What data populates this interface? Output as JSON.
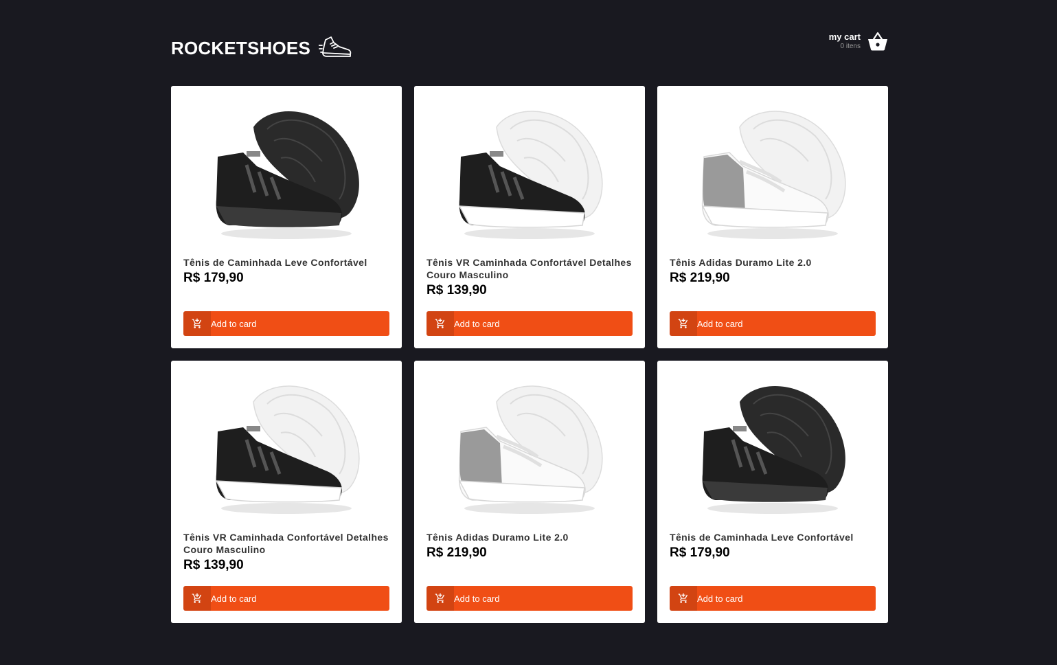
{
  "header": {
    "logo_text": "ROCKETSHOES",
    "logo_icon": "running-shoe-icon",
    "cart_title": "my cart",
    "cart_count": "0 itens",
    "cart_icon": "shopping-basket-icon"
  },
  "colors": {
    "background": "#191920",
    "accent": "#f04e15",
    "card": "#ffffff"
  },
  "products": [
    {
      "title": "Tênis de Caminhada Leve Confortável",
      "price": "R$ 179,90",
      "button_label": "Add to card",
      "button_icon": "add-shopping-cart-icon",
      "shoe": "black"
    },
    {
      "title": "Tênis VR Caminhada Confortável Detalhes Couro Masculino",
      "price": "R$ 139,90",
      "button_label": "Add to card",
      "button_icon": "add-shopping-cart-icon",
      "shoe": "black-white"
    },
    {
      "title": "Tênis Adidas Duramo Lite 2.0",
      "price": "R$ 219,90",
      "button_label": "Add to card",
      "button_icon": "add-shopping-cart-icon",
      "shoe": "white-grey"
    },
    {
      "title": "Tênis VR Caminhada Confortável Detalhes Couro Masculino",
      "price": "R$ 139,90",
      "button_label": "Add to card",
      "button_icon": "add-shopping-cart-icon",
      "shoe": "black-white"
    },
    {
      "title": "Tênis Adidas Duramo Lite 2.0",
      "price": "R$ 219,90",
      "button_label": "Add to card",
      "button_icon": "add-shopping-cart-icon",
      "shoe": "white-grey"
    },
    {
      "title": "Tênis de Caminhada Leve Confortável",
      "price": "R$ 179,90",
      "button_label": "Add to card",
      "button_icon": "add-shopping-cart-icon",
      "shoe": "black"
    }
  ]
}
